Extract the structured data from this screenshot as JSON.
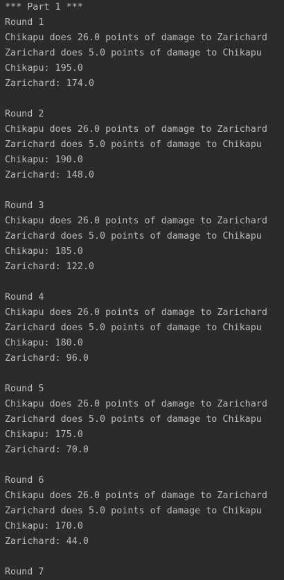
{
  "console": {
    "header": "*** Part 1 ***",
    "rounds": [
      {
        "title": "Round 1",
        "lines": [
          "Chikapu does 26.0 points of damage to Zarichard",
          "Zarichard does 5.0 points of damage to Chikapu",
          "Chikapu: 195.0",
          "Zarichard: 174.0"
        ]
      },
      {
        "title": "Round 2",
        "lines": [
          "Chikapu does 26.0 points of damage to Zarichard",
          "Zarichard does 5.0 points of damage to Chikapu",
          "Chikapu: 190.0",
          "Zarichard: 148.0"
        ]
      },
      {
        "title": "Round 3",
        "lines": [
          "Chikapu does 26.0 points of damage to Zarichard",
          "Zarichard does 5.0 points of damage to Chikapu",
          "Chikapu: 185.0",
          "Zarichard: 122.0"
        ]
      },
      {
        "title": "Round 4",
        "lines": [
          "Chikapu does 26.0 points of damage to Zarichard",
          "Zarichard does 5.0 points of damage to Chikapu",
          "Chikapu: 180.0",
          "Zarichard: 96.0"
        ]
      },
      {
        "title": "Round 5",
        "lines": [
          "Chikapu does 26.0 points of damage to Zarichard",
          "Zarichard does 5.0 points of damage to Chikapu",
          "Chikapu: 175.0",
          "Zarichard: 70.0"
        ]
      },
      {
        "title": "Round 6",
        "lines": [
          "Chikapu does 26.0 points of damage to Zarichard",
          "Zarichard does 5.0 points of damage to Chikapu",
          "Chikapu: 170.0",
          "Zarichard: 44.0"
        ]
      },
      {
        "title": "Round 7",
        "lines": []
      }
    ]
  },
  "colors": {
    "background": "#2b2b2b",
    "text": "#bbbbbb"
  }
}
